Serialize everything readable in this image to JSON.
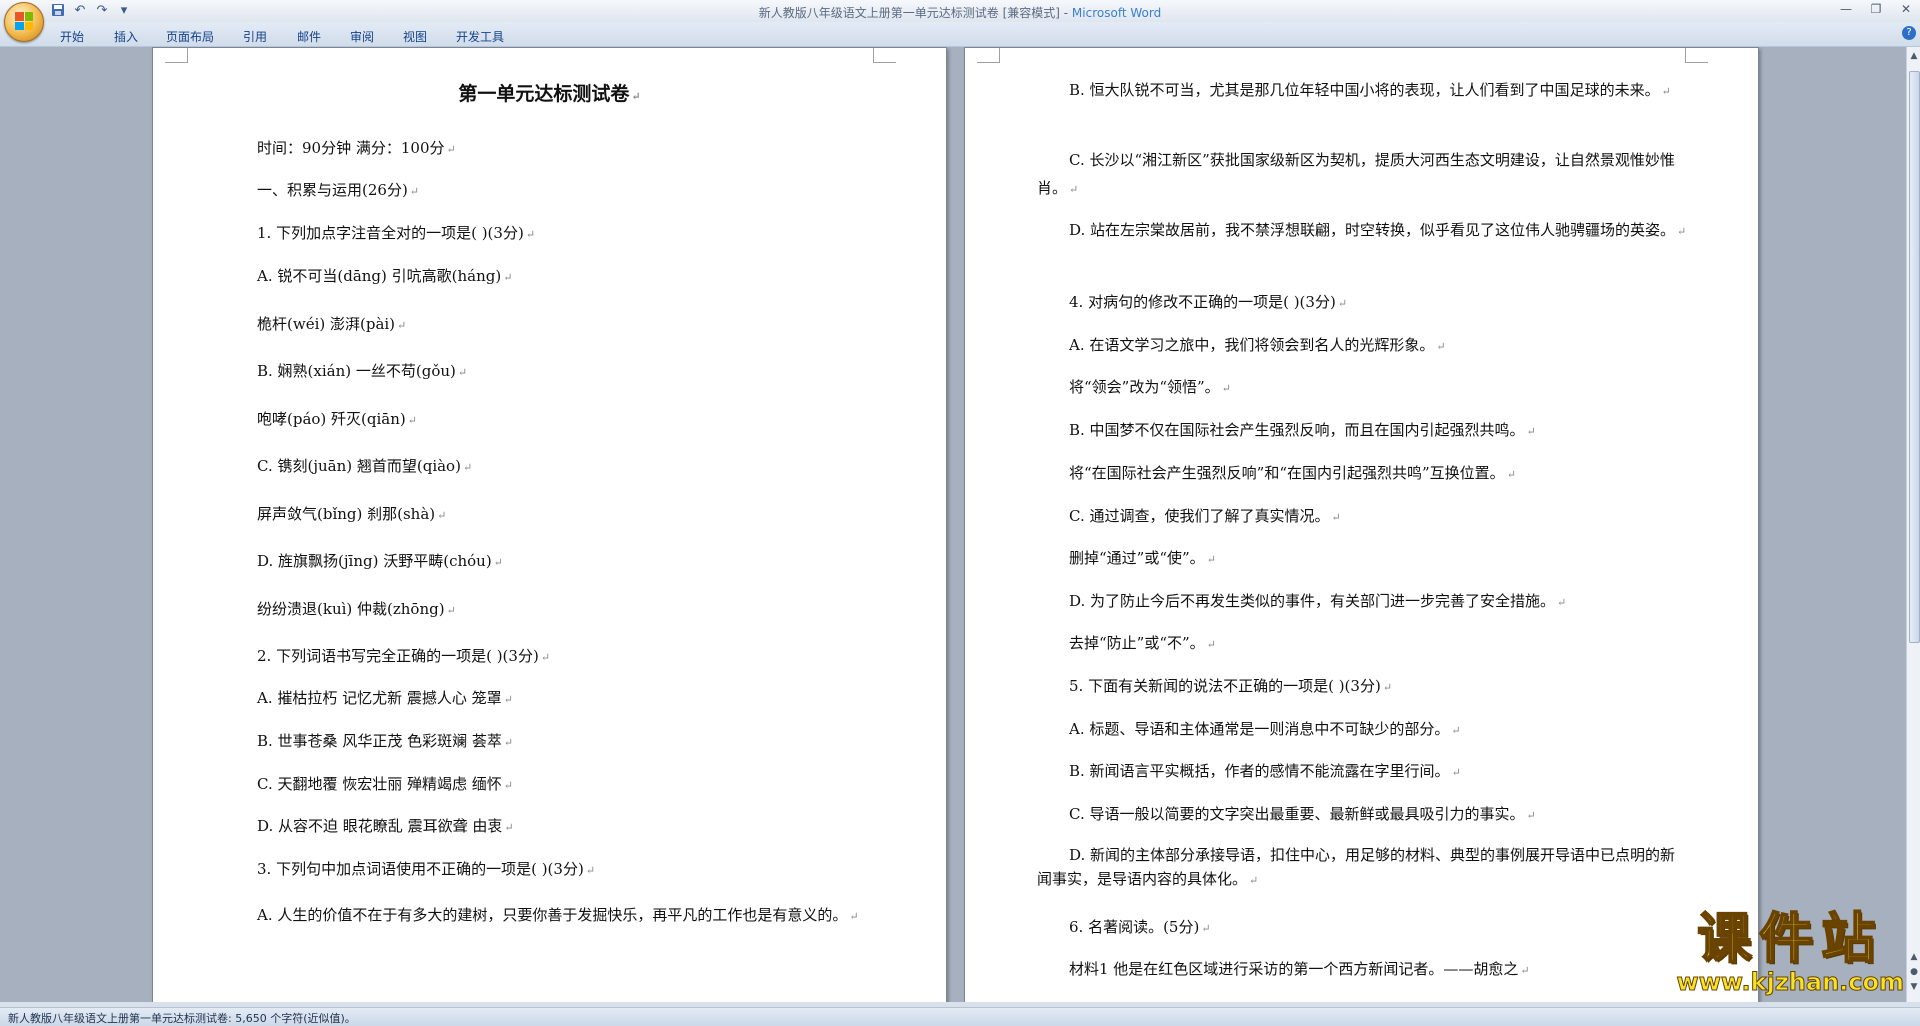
{
  "window": {
    "title": "新人教版八年级语文上册第一单元达标测试卷 [兼容模式] - ",
    "app_name": "Microsoft Word"
  },
  "qat": {
    "icons": [
      "save-icon",
      "undo-icon",
      "redo-icon",
      "customize-icon"
    ],
    "undo": "↶",
    "redo": "↷",
    "customize": "▾"
  },
  "ribbon": {
    "tabs": [
      "开始",
      "插入",
      "页面布局",
      "引用",
      "邮件",
      "审阅",
      "视图",
      "开发工具"
    ]
  },
  "left_page": {
    "title": "第一单元达标测试卷",
    "paragraphs": [
      "时间：90分钟  满分：100分",
      "一、积累与运用(26分)",
      "1. 下列加点字注音全对的一项是(    )(3分)",
      "A. 锐不可当(dāng)         引吭高歌(háng)",
      "桅杆(wéi)  澎湃(pài)",
      "B. 娴熟(xián)  一丝不苟(gǒu)",
      "咆哮(páo)  歼灭(qiān)",
      "C. 镌刻(juān)  翘首而望(qiào)",
      "屏声敛气(bǐng)  刹那(shà)",
      "D. 旌旗飘扬(jīng)  沃野平畴(chóu)",
      "纷纷溃退(kuì)  仲裁(zhōng)",
      "2. 下列词语书写完全正确的一项是(    )(3分)",
      "A. 摧枯拉朽     记忆尤新     震撼人心     笼罩",
      "B. 世事苍桑   风华正茂   色彩斑斓   荟萃",
      "C. 天翻地覆   恢宏壮丽   殚精竭虑   缅怀",
      "D. 从容不迫   眼花瞭乱   震耳欲聋   由衷",
      "3. 下列句中加点词语使用不正确的一项是(    )(3分)",
      "A. 人生的价值不在于有多大的建树，只要你善于发掘快乐，再平凡的工作也是有意义的。"
    ]
  },
  "right_page": {
    "paragraphs": [
      "B. 恒大队锐不可当，尤其是那几位年轻中国小将的表现，让人们看到了中国足球的未来。",
      "C. 长沙以“湘江新区”获批国家级新区为契机，提质大河西生态文明建设，让自然景观惟妙惟肖。",
      "D. 站在左宗棠故居前，我不禁浮想联翩，时空转换，似乎看见了这位伟人驰骋疆场的英姿。",
      "4. 对病句的修改不正确的一项是(    )(3分)",
      "A. 在语文学习之旅中，我们将领会到名人的光辉形象。",
      "将“领会”改为“领悟”。",
      "B. 中国梦不仅在国际社会产生强烈反响，而且在国内引起强烈共鸣。",
      "将“在国际社会产生强烈反响”和“在国内引起强烈共鸣”互换位置。",
      "C. 通过调查，使我们了解了真实情况。",
      "删掉“通过”或“使”。",
      "D. 为了防止今后不再发生类似的事件，有关部门进一步完善了安全措施。",
      "去掉“防止”或“不”。",
      "5. 下面有关新闻的说法不正确的一项是(    )(3分)",
      "A. 标题、导语和主体通常是一则消息中不可缺少的部分。",
      "B. 新闻语言平实概括，作者的感情不能流露在字里行间。",
      "C. 导语一般以简要的文字突出最重要、最新鲜或最具吸引力的事实。",
      "D. 新闻的主体部分承接导语，扣住中心，用足够的材料、典型的事例展开导语中已点明的新闻事实，是导语内容的具体化。",
      "6. 名著阅读。(5分)",
      "材料1  他是在红色区域进行采访的第一个西方新闻记者。——胡愈之"
    ]
  },
  "status_bar": {
    "text": "新人教版八年级语文上册第一单元达标测试卷: 5,650 个字符(近似值)。"
  },
  "watermark": {
    "title": "课件站",
    "url": "www.kjzhan.com"
  },
  "colors": {
    "ribbon_text": "#15428b",
    "workspace": "#a6b0be",
    "watermark": "#f7e326"
  }
}
